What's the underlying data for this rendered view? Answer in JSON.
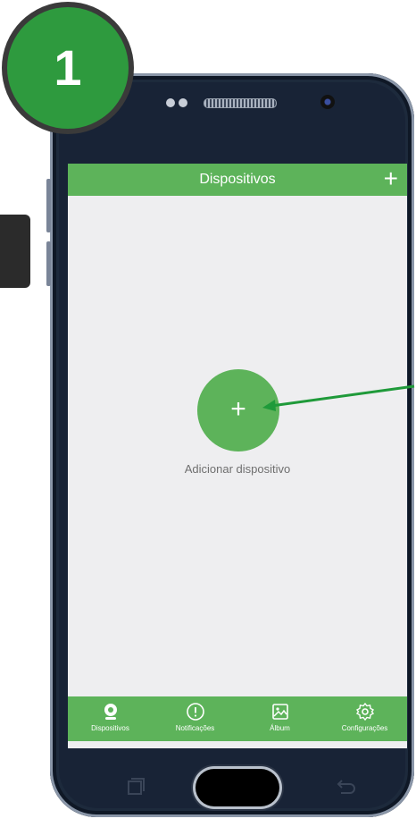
{
  "step_badge": "1",
  "app": {
    "header_title": "Dispositivos",
    "header_add": "+",
    "add_button_symbol": "+",
    "add_device_label": "Adicionar dispositivo"
  },
  "tabs": [
    {
      "label": "Dispositivos",
      "icon": "camera-icon"
    },
    {
      "label": "Notificações",
      "icon": "alert-circle-icon"
    },
    {
      "label": "Álbum",
      "icon": "image-icon"
    },
    {
      "label": "Configurações",
      "icon": "gear-icon"
    }
  ],
  "colors": {
    "accent": "#5db35a",
    "badge": "#2e9a3e",
    "arrow": "#1f9a3a",
    "screen_bg": "#eeeef0"
  }
}
